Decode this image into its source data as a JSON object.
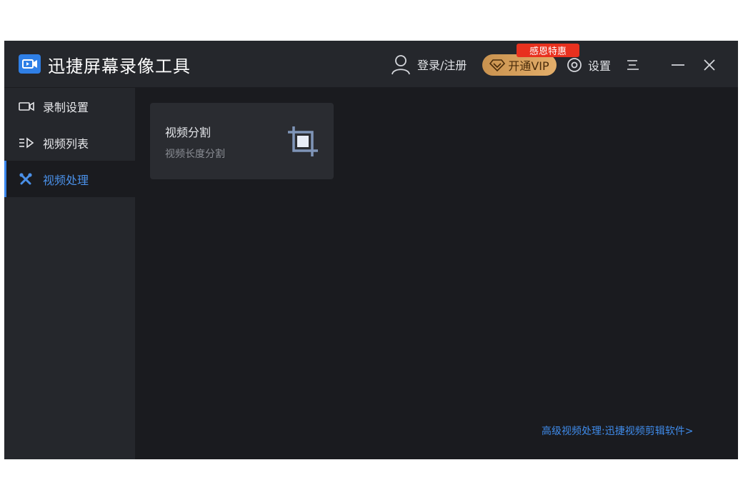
{
  "window": {
    "title": "迅捷屏幕录像工具"
  },
  "header": {
    "login_label": "登录/注册",
    "vip_label": "开通VIP",
    "promo_badge": "感恩特惠",
    "settings_label": "设置",
    "icons": {
      "logo": "video-camera-logo-icon",
      "user": "user-icon",
      "vip": "diamond-icon",
      "settings": "gear-icon",
      "menu": "menu-icon",
      "minimize": "minimize-icon",
      "close": "close-icon"
    }
  },
  "sidebar": {
    "items": [
      {
        "label": "录制设置",
        "icon": "video-camera-icon",
        "active": false
      },
      {
        "label": "视频列表",
        "icon": "list-play-icon",
        "active": false
      },
      {
        "label": "视频处理",
        "icon": "tools-icon",
        "active": true
      }
    ]
  },
  "main": {
    "cards": [
      {
        "title": "视频分割",
        "subtitle": "视频长度分割",
        "icon": "crop-icon"
      }
    ],
    "footer_link": "高级视频处理:迅捷视频剪辑软件>"
  },
  "colors": {
    "accent": "#3a86ec",
    "background": "#1a1b1f",
    "panel": "#25272c",
    "card": "#2a2c31",
    "promo": "#e8311f",
    "vip": "#d6a05d"
  }
}
